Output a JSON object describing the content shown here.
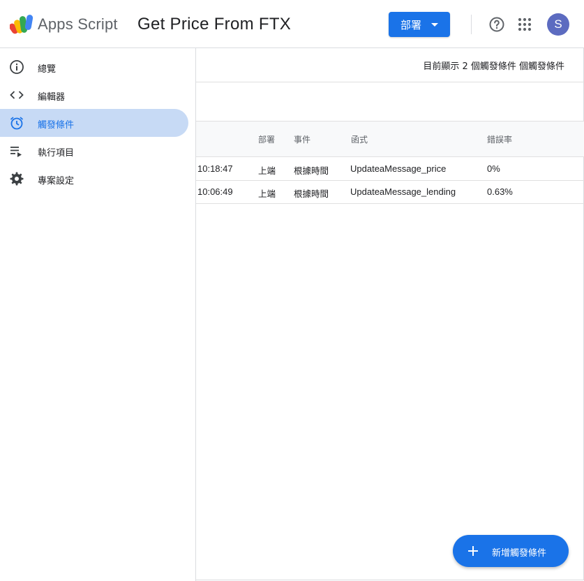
{
  "header": {
    "app_name": "Apps Script",
    "project_title": "Get Price From FTX",
    "deploy_label": "部署",
    "avatar_initial": "S"
  },
  "sidebar": {
    "items": [
      {
        "label": "總覽",
        "icon": "info-icon",
        "active": false
      },
      {
        "label": "編輯器",
        "icon": "code-icon",
        "active": false
      },
      {
        "label": "觸發條件",
        "icon": "alarm-clock-icon",
        "active": true
      },
      {
        "label": "執行項目",
        "icon": "queue-play-icon",
        "active": false
      },
      {
        "label": "專案設定",
        "icon": "gear-icon",
        "active": false
      }
    ]
  },
  "main": {
    "summary": "目前顯示 2 個觸發條件 個觸發條件",
    "table": {
      "columns": [
        "部署",
        "事件",
        "函式",
        "錯誤率"
      ],
      "rows": [
        {
          "time": "10:18:47",
          "deployment": "上端",
          "event": "根據時間",
          "function": "UpdateaMessage_price",
          "error_rate": "0%"
        },
        {
          "time": "10:06:49",
          "deployment": "上端",
          "event": "根據時間",
          "function": "UpdateaMessage_lending",
          "error_rate": "0.63%"
        }
      ]
    }
  },
  "fab": {
    "label": "新增觸發條件"
  },
  "colors": {
    "accent": "#1a73e8",
    "active_nav_bg": "#c7daf5",
    "avatar_bg": "#5c6bc0"
  }
}
